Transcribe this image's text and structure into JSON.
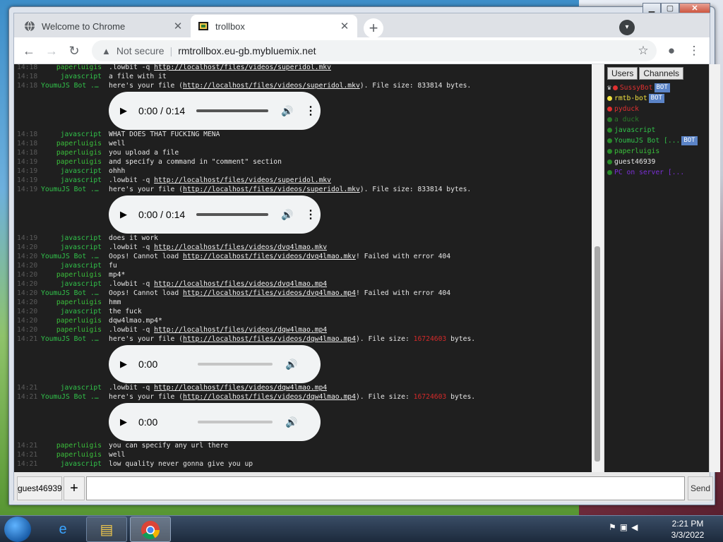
{
  "browser": {
    "tabs": [
      {
        "title": "Welcome to Chrome",
        "icon": "globe-icon"
      },
      {
        "title": "trollbox",
        "icon": "film-icon"
      }
    ],
    "new_tab": "+",
    "security": "Not secure",
    "url": "rmtrollbox.eu-gb.mybluemix.net"
  },
  "colors": {
    "you": "#3bbf3b",
    "bot": "#31c24a",
    "red": "#d32a2a",
    "purple": "#7b2fd6"
  },
  "chat": {
    "lines": [
      {
        "type": "msg",
        "time": "14:18",
        "nick": "paperluigis",
        "color": "#3bbf3b",
        "parts": [
          {
            "t": ".lowbit -q "
          },
          {
            "t": "http://localhost/files/videos/superidol.mkv",
            "link": true
          }
        ]
      },
      {
        "type": "msg",
        "time": "14:18",
        "nick": "javascript",
        "color": "#31c24a",
        "parts": [
          {
            "t": "a file with it"
          }
        ]
      },
      {
        "type": "msg",
        "time": "14:18",
        "nick": "YoumuJS Bot ...",
        "color": "#31c24a",
        "parts": [
          {
            "t": "here's your file ("
          },
          {
            "t": "http://localhost/files/videos/superidol.mkv",
            "link": true
          },
          {
            "t": "). File size: 833814 bytes."
          }
        ]
      },
      {
        "type": "player",
        "time": "0:00 / 0:14",
        "seek": 0,
        "more": true
      },
      {
        "type": "msg",
        "time": "14:18",
        "nick": "javascript",
        "color": "#31c24a",
        "parts": [
          {
            "t": "WHAT DOES THAT FUCKING MENA"
          }
        ]
      },
      {
        "type": "msg",
        "time": "14:18",
        "nick": "paperluigis",
        "color": "#3bbf3b",
        "parts": [
          {
            "t": "well"
          }
        ]
      },
      {
        "type": "msg",
        "time": "14:18",
        "nick": "paperluigis",
        "color": "#3bbf3b",
        "parts": [
          {
            "t": "you upload a file"
          }
        ]
      },
      {
        "type": "msg",
        "time": "14:19",
        "nick": "paperluigis",
        "color": "#3bbf3b",
        "parts": [
          {
            "t": "and specify a command in \"comment\" section"
          }
        ]
      },
      {
        "type": "msg",
        "time": "14:19",
        "nick": "javascript",
        "color": "#31c24a",
        "parts": [
          {
            "t": "ohhh"
          }
        ]
      },
      {
        "type": "msg",
        "time": "14:19",
        "nick": "javascript",
        "color": "#31c24a",
        "parts": [
          {
            "t": ".lowbit -q "
          },
          {
            "t": "http://localhost/files/videos/superidol.mkv",
            "link": true
          }
        ]
      },
      {
        "type": "msg",
        "time": "14:19",
        "nick": "YoumuJS Bot ...",
        "color": "#31c24a",
        "parts": [
          {
            "t": "here's your file ("
          },
          {
            "t": "http://localhost/files/videos/superidol.mkv",
            "link": true
          },
          {
            "t": "). File size: 833814 bytes."
          }
        ]
      },
      {
        "type": "player",
        "time": "0:00 / 0:14",
        "seek": 0,
        "more": true
      },
      {
        "type": "msg",
        "time": "14:19",
        "nick": "javascript",
        "color": "#31c24a",
        "parts": [
          {
            "t": "does it work"
          }
        ]
      },
      {
        "type": "msg",
        "time": "14:20",
        "nick": "javascript",
        "color": "#31c24a",
        "parts": [
          {
            "t": ".lowbit -q "
          },
          {
            "t": "http://localhost/files/videos/dvq4lmao.mkv",
            "link": true
          }
        ]
      },
      {
        "type": "msg",
        "time": "14:20",
        "nick": "YoumuJS Bot ...",
        "color": "#31c24a",
        "parts": [
          {
            "t": "Oops! Cannot load "
          },
          {
            "t": "http://localhost/files/videos/dvq4lmao.mkv",
            "link": true
          },
          {
            "t": "! Failed with error 404"
          }
        ]
      },
      {
        "type": "msg",
        "time": "14:20",
        "nick": "javascript",
        "color": "#31c24a",
        "parts": [
          {
            "t": "fu"
          }
        ]
      },
      {
        "type": "msg",
        "time": "14:20",
        "nick": "paperluigis",
        "color": "#3bbf3b",
        "parts": [
          {
            "t": "mp4*"
          }
        ]
      },
      {
        "type": "msg",
        "time": "14:20",
        "nick": "javascript",
        "color": "#31c24a",
        "parts": [
          {
            "t": ".lowbit -q "
          },
          {
            "t": "http://localhost/files/videos/dvq4lmao.mp4",
            "link": true
          }
        ]
      },
      {
        "type": "msg",
        "time": "14:20",
        "nick": "YoumuJS Bot ...",
        "color": "#31c24a",
        "parts": [
          {
            "t": "Oops! Cannot load "
          },
          {
            "t": "http://localhost/files/videos/dvq4lmao.mp4",
            "link": true
          },
          {
            "t": "! Failed with error 404"
          }
        ]
      },
      {
        "type": "msg",
        "time": "14:20",
        "nick": "paperluigis",
        "color": "#3bbf3b",
        "parts": [
          {
            "t": "hmm"
          }
        ]
      },
      {
        "type": "msg",
        "time": "14:20",
        "nick": "javascript",
        "color": "#31c24a",
        "parts": [
          {
            "t": "the fuck"
          }
        ]
      },
      {
        "type": "msg",
        "time": "14:20",
        "nick": "paperluigis",
        "color": "#3bbf3b",
        "parts": [
          {
            "t": "dqw4lmao.mp4*"
          }
        ]
      },
      {
        "type": "msg",
        "time": "14:20",
        "nick": "paperluigis",
        "color": "#3bbf3b",
        "parts": [
          {
            "t": ".lowbit -q "
          },
          {
            "t": "http://localhost/files/videos/dqw4lmao.mp4",
            "link": true
          }
        ]
      },
      {
        "type": "msg",
        "time": "14:21",
        "nick": "YoumuJS Bot ...",
        "color": "#31c24a",
        "parts": [
          {
            "t": "here's your file ("
          },
          {
            "t": "http://localhost/files/videos/dqw4lmao.mp4",
            "link": true
          },
          {
            "t": "). File size: "
          },
          {
            "t": "16724603",
            "red": true
          },
          {
            "t": " bytes."
          }
        ]
      },
      {
        "type": "player",
        "time": "0:00",
        "seek": 0,
        "more": false
      },
      {
        "type": "msg",
        "time": "14:21",
        "nick": "javascript",
        "color": "#31c24a",
        "parts": [
          {
            "t": ".lowbit -q "
          },
          {
            "t": "http://localhost/files/videos/dqw4lmao.mp4",
            "link": true
          }
        ]
      },
      {
        "type": "msg",
        "time": "14:21",
        "nick": "YoumuJS Bot ...",
        "color": "#31c24a",
        "parts": [
          {
            "t": "here's your file ("
          },
          {
            "t": "http://localhost/files/videos/dqw4lmao.mp4",
            "link": true
          },
          {
            "t": "). File size: "
          },
          {
            "t": "16724603",
            "red": true
          },
          {
            "t": " bytes."
          }
        ]
      },
      {
        "type": "player",
        "time": "0:00",
        "seek": 0,
        "more": false
      },
      {
        "type": "msg",
        "time": "14:21",
        "nick": "paperluigis",
        "color": "#3bbf3b",
        "parts": [
          {
            "t": "you can specify any url there"
          }
        ]
      },
      {
        "type": "msg",
        "time": "14:21",
        "nick": "paperluigis",
        "color": "#3bbf3b",
        "parts": [
          {
            "t": "well"
          }
        ]
      },
      {
        "type": "msg",
        "time": "14:21",
        "nick": "javascript",
        "color": "#31c24a",
        "parts": [
          {
            "t": "low quality never gonna give you up"
          }
        ]
      }
    ]
  },
  "users_panel": {
    "tabs": [
      "Users",
      "Channels"
    ],
    "users": [
      {
        "name": "SussyBot",
        "color": "#e03030",
        "dot": "#e03030",
        "prefix": "♛",
        "bot": true
      },
      {
        "name": "rmtb-bot",
        "color": "#f0e040",
        "dot": "#f0e040",
        "bot": true
      },
      {
        "name": "pyduck",
        "color": "#e03030",
        "dot": "#e03030",
        "bot": false
      },
      {
        "name": "a duck",
        "color": "#2a7a2a",
        "dot": "#2a7a2a",
        "bot": false
      },
      {
        "name": "javascript",
        "color": "#31c24a",
        "dot": "#2a8a2a",
        "bot": false
      },
      {
        "name": "YoumuJS Bot [...",
        "color": "#31c24a",
        "dot": "#2a8a2a",
        "bot": true
      },
      {
        "name": "paperluigis",
        "color": "#3bbf3b",
        "dot": "#2a8a2a",
        "bot": false
      },
      {
        "name": "guest46939",
        "color": "#e6e6e6",
        "dot": "#2a8a2a",
        "bot": false
      },
      {
        "name": "PC on server [...",
        "color": "#7b2fd6",
        "dot": "#2a8a2a",
        "bot": false
      }
    ],
    "bot_badge": "BOT"
  },
  "input": {
    "nick": "guest46939",
    "plus": "+",
    "placeholder": "",
    "send": "Send"
  },
  "taskbar": {
    "time": "2:21 PM",
    "date": "3/3/2022"
  }
}
